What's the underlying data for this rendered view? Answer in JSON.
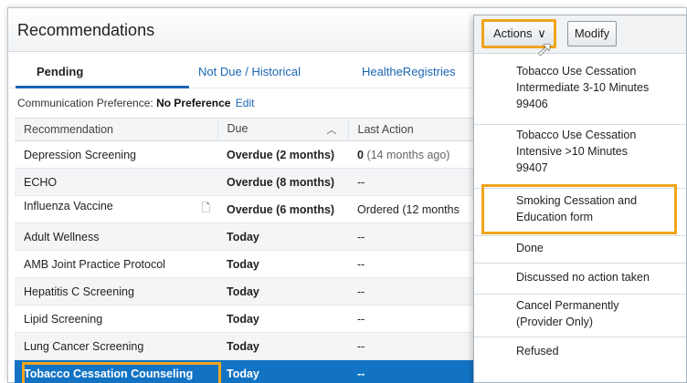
{
  "panel": {
    "title": "Recommendations"
  },
  "tabs": [
    {
      "label": "Pending"
    },
    {
      "label": "Not Due / Historical"
    },
    {
      "label": "HealtheRegistries"
    }
  ],
  "communication": {
    "label": "Communication Preference:",
    "value": "No Preference",
    "edit_label": "Edit"
  },
  "table": {
    "headers": [
      "Recommendation",
      "Due",
      "Last Action"
    ],
    "rows": [
      {
        "name": "Depression Screening",
        "due": "Overdue (2 months)",
        "last_bold": "0",
        "last": "(14 months ago)"
      },
      {
        "name": "ECHO",
        "due": "Overdue (8 months)",
        "last_bold": "",
        "last": "--"
      },
      {
        "name": "Influenza Vaccine",
        "due": "Overdue (6 months)",
        "last_bold": "",
        "last": "Ordered (12 months"
      },
      {
        "name": "Adult Wellness",
        "due": "Today",
        "last_bold": "",
        "last": "--"
      },
      {
        "name": "AMB Joint Practice Protocol",
        "due": "Today",
        "last_bold": "",
        "last": "--"
      },
      {
        "name": "Hepatitis C Screening",
        "due": "Today",
        "last_bold": "",
        "last": "--"
      },
      {
        "name": "Lipid Screening",
        "due": "Today",
        "last_bold": "",
        "last": "--"
      },
      {
        "name": "Lung Cancer Screening",
        "due": "Today",
        "last_bold": "",
        "last": "--"
      },
      {
        "name": "Tobacco Cessation Counseling",
        "due": "Today",
        "last_bold": "",
        "last": "--"
      }
    ]
  },
  "toolbar": {
    "actions_label": "Actions",
    "modify_label": "Modify"
  },
  "menu": {
    "items": [
      {
        "lines": [
          "Tobacco Use Cessation",
          "Intermediate 3-10 Minutes",
          "99406"
        ]
      },
      {
        "lines": [
          "Tobacco Use Cessation",
          "Intensive >10 Minutes",
          "99407"
        ]
      },
      {
        "lines": [
          "Smoking Cessation and",
          "Education form"
        ]
      },
      {
        "lines": [
          "Done"
        ]
      },
      {
        "lines": [
          "Discussed no action taken"
        ]
      },
      {
        "lines": [
          "Cancel Permanently",
          "(Provider Only)"
        ]
      },
      {
        "lines": [
          "Refused"
        ]
      }
    ]
  },
  "colors": {
    "accent": "#1a66b3",
    "overdue": "#d60000",
    "selection": "#1273c4",
    "highlight": "#f0a41c"
  }
}
